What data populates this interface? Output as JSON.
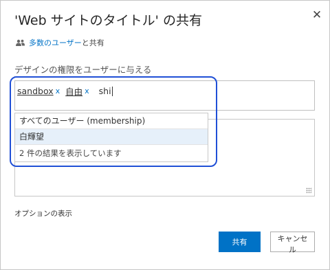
{
  "dialog": {
    "title": "'Web サイトのタイトル' の共有",
    "close_icon": "close-icon"
  },
  "shared_with": {
    "icon": "people-icon",
    "link_text": "多数のユーザー",
    "suffix_text": "と共有"
  },
  "permission_label": "デザインの権限をユーザーに与える",
  "people_picker": {
    "tokens": [
      {
        "label": "sandbox",
        "remove": "x"
      },
      {
        "label": "自由",
        "remove": "x"
      }
    ],
    "typed_text": "shi"
  },
  "suggestions": {
    "items": [
      "すべてのユーザー (membership)",
      "白輝望"
    ],
    "highlighted_index": 1,
    "status": "2 件の結果を表示しています"
  },
  "options_link": "オプションの表示",
  "buttons": {
    "share": "共有",
    "cancel": "キャンセル"
  },
  "colors": {
    "accent": "#0072c6",
    "annotation": "#1f4fd6",
    "highlight": "#e6f0fa"
  }
}
